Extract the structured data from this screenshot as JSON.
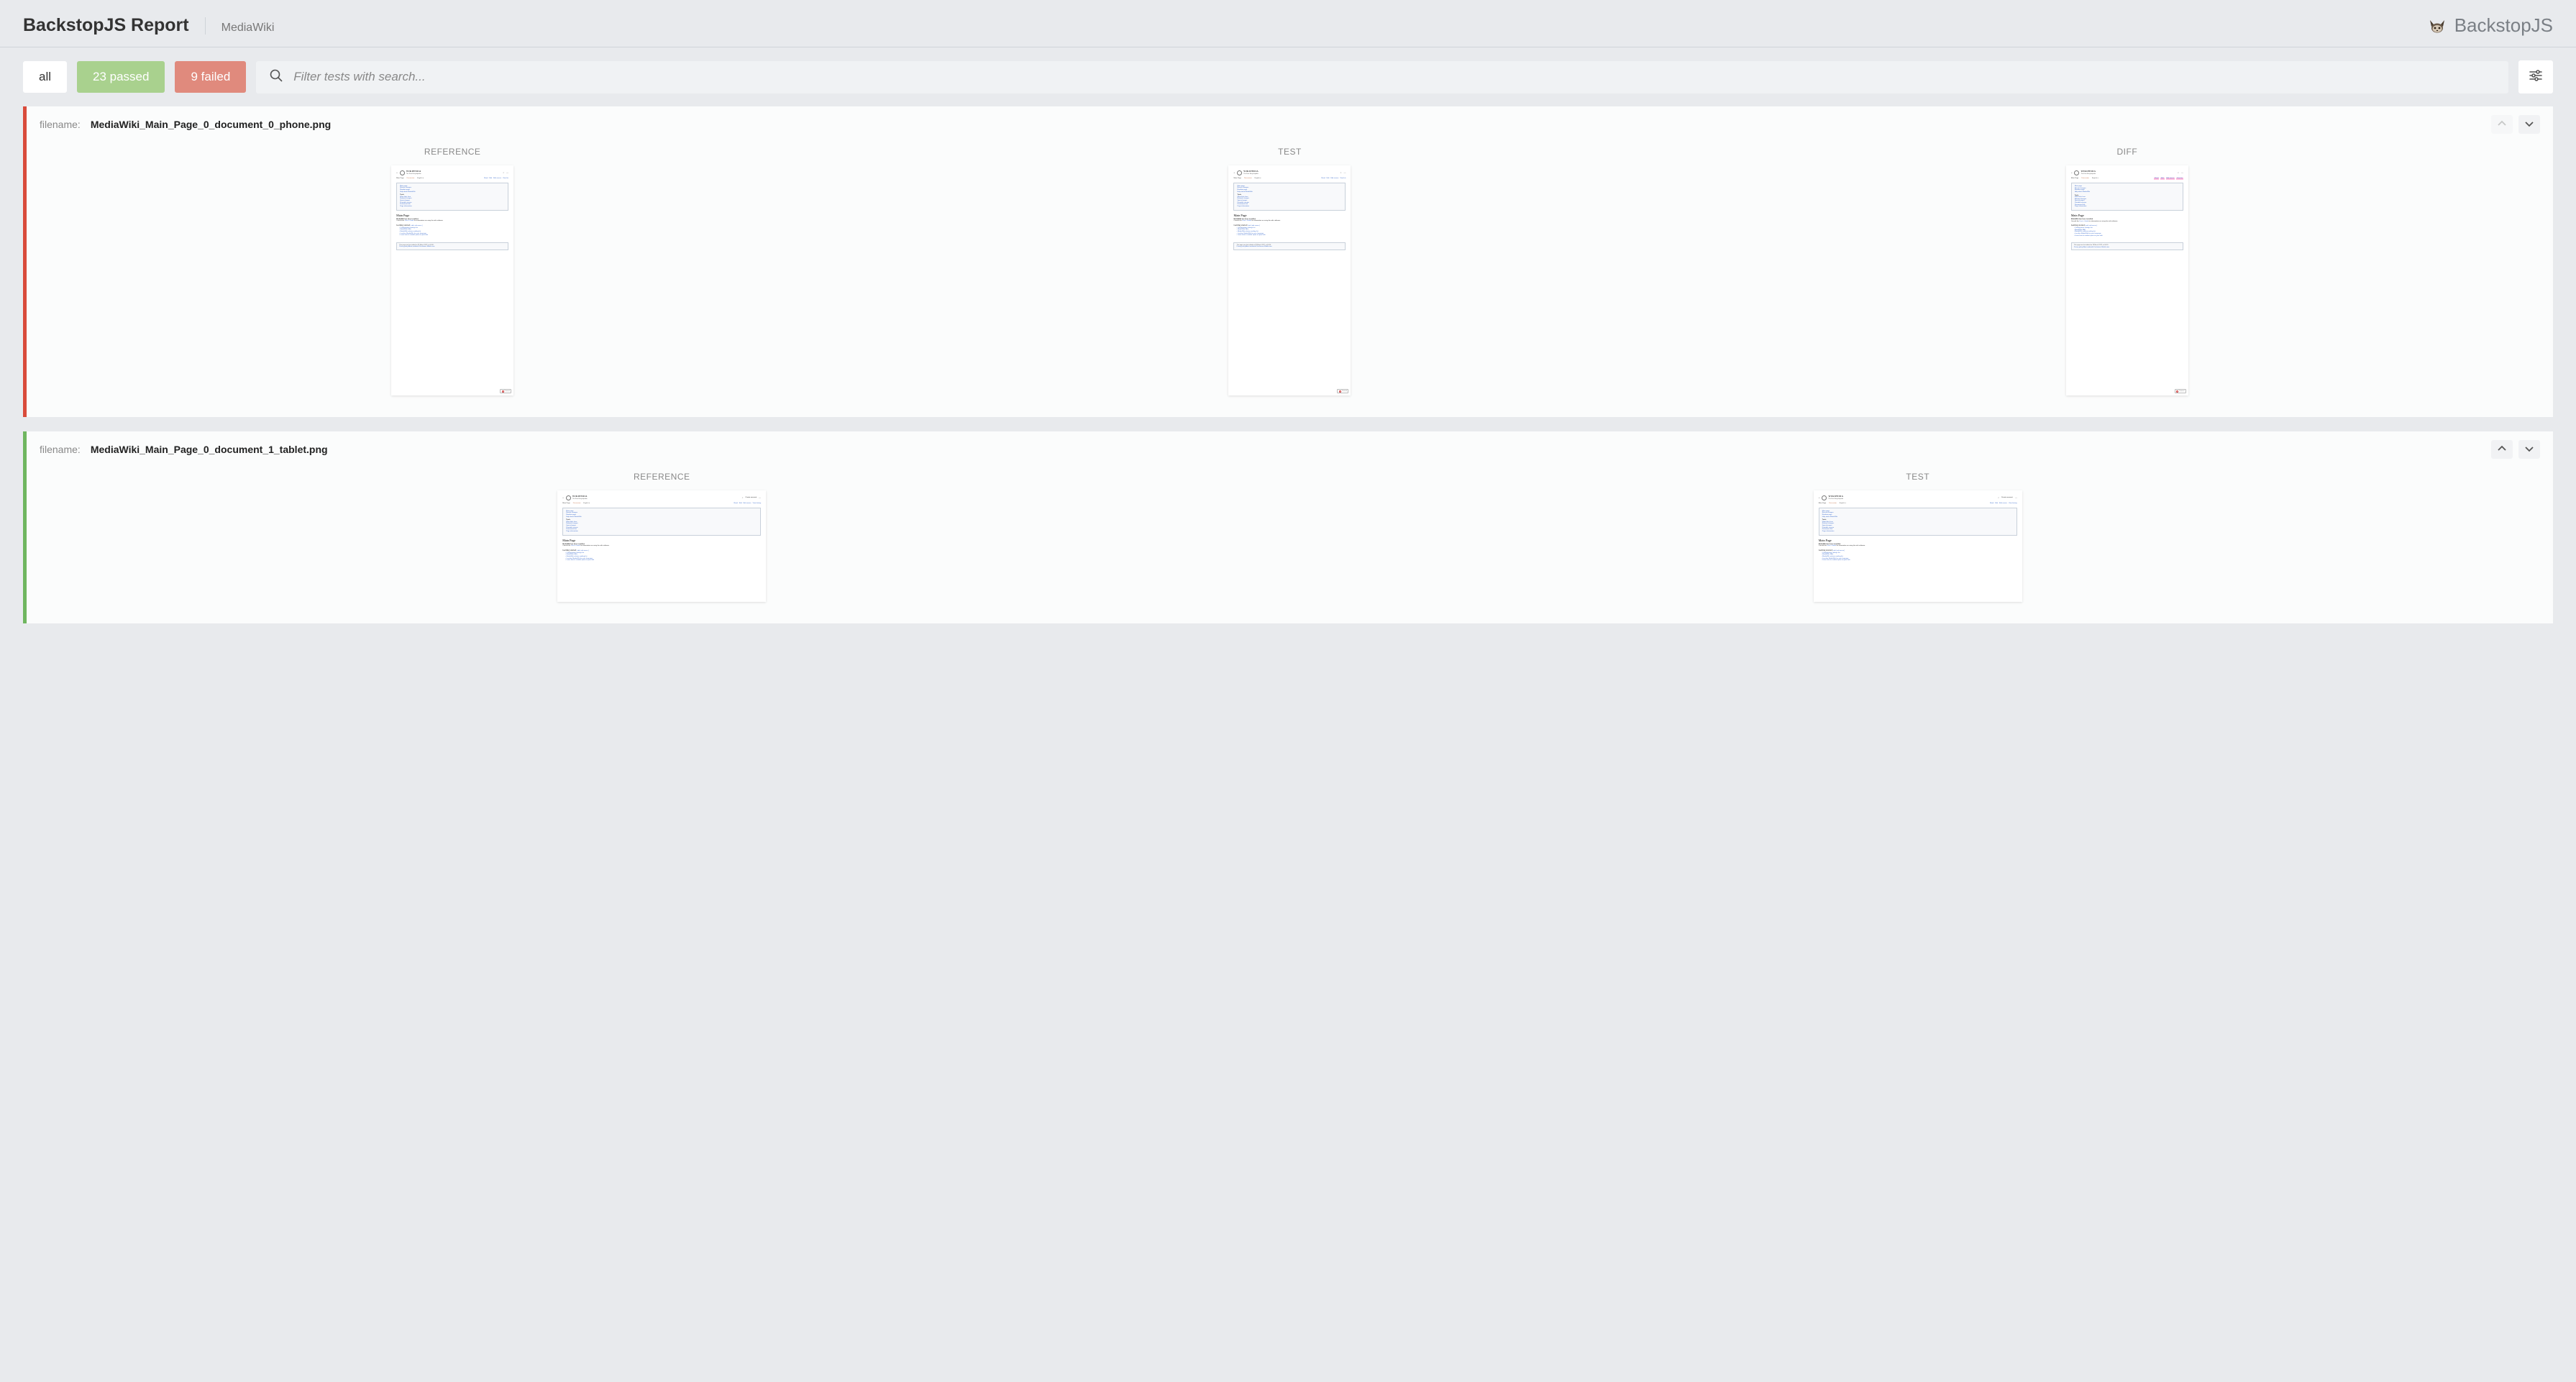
{
  "header": {
    "title": "BackstopJS Report",
    "project": "MediaWiki",
    "brand": "BackstopJS"
  },
  "filters": {
    "all": "all",
    "passed": "23 passed",
    "failed": "9 failed"
  },
  "search": {
    "placeholder": "Filter tests with search..."
  },
  "labels": {
    "filename": "filename:",
    "reference": "REFERENCE",
    "test": "TEST",
    "diff": "DIFF"
  },
  "reports": [
    {
      "status": "fail",
      "filename": "MediaWiki_Main_Page_0_document_0_phone.png",
      "hasDiff": true,
      "prevDisabled": true,
      "nextDisabled": false
    },
    {
      "status": "pass",
      "filename": "MediaWiki_Main_Page_0_document_1_tablet.png",
      "hasDiff": false,
      "prevDisabled": false,
      "nextDisabled": false
    }
  ],
  "thumbContent": {
    "siteTitle": "WIKIPEDIA",
    "siteSub": "The Free Encyclopedia",
    "tabMain": "Main Page",
    "tabDiscussion": "Discussion",
    "tabLang": "English",
    "createAccount": "Create account",
    "rightTabs": [
      "Read",
      "Edit",
      "Edit source",
      "View his"
    ],
    "rightTabsWide": [
      "Read",
      "Edit",
      "Edit source",
      "View history"
    ],
    "navItems": [
      "Main page",
      "Recent changes",
      "Random page",
      "Help about MediaWiki"
    ],
    "toolsHeader": "Tools",
    "toolItems": [
      "What links here",
      "Related changes",
      "Special pages",
      "Printable version",
      "Permanent link",
      "Page information"
    ],
    "h1": "Main Page",
    "installed": "MediaWiki has been installed.",
    "consult": "Consult the User's Guide for information on using the wiki software.",
    "gettingStarted": "Getting started",
    "gettingStartedLinks": "[ edit | edit source ]",
    "bullets": [
      "Configuration settings list",
      "MediaWiki FAQ",
      "MediaWiki release mailing list",
      "Localise MediaWiki for your language",
      "Learn how to combat spam on your wiki"
    ],
    "footerEdited": "This page was last edited on 28 March 2022, at 00:30.",
    "footerLinks": "Privacy policy   About mediawiki   Disclaimers   Mobile view",
    "poweredBy": "Powered by MediaWiki"
  }
}
